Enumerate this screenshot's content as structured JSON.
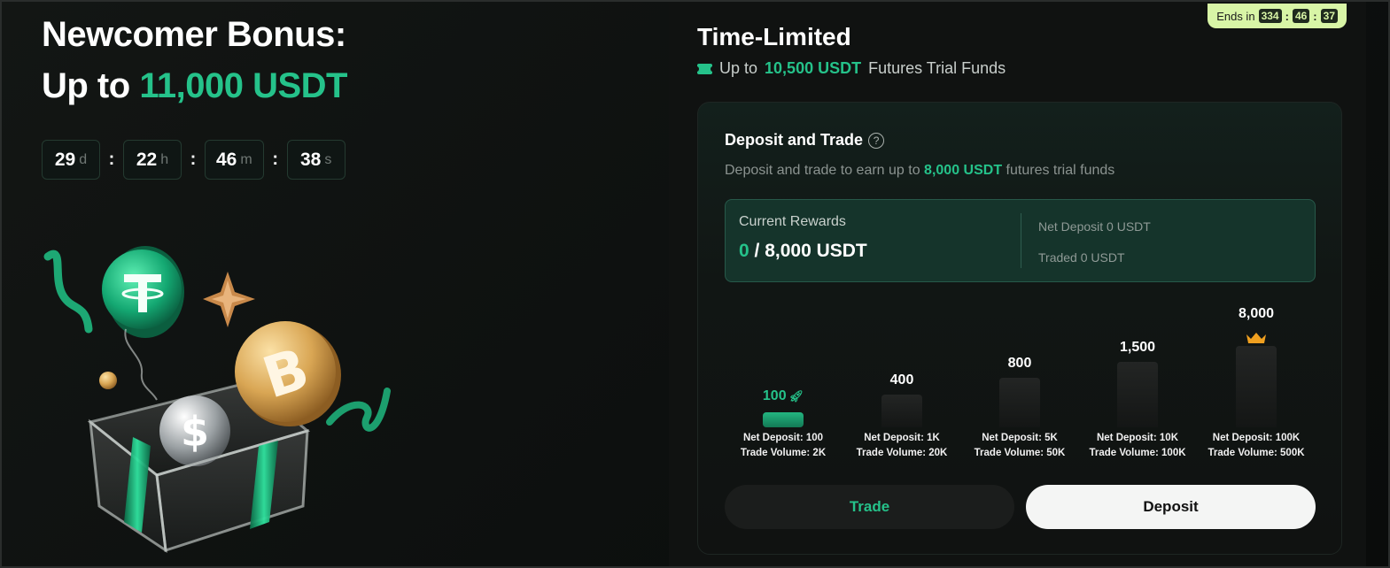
{
  "hero": {
    "title_line1": "Newcomer Bonus:",
    "title_prefix": "Up to",
    "title_amount": "11,000 USDT"
  },
  "countdown": [
    {
      "value": "29",
      "unit": "d"
    },
    {
      "value": "22",
      "unit": "h"
    },
    {
      "value": "46",
      "unit": "m"
    },
    {
      "value": "38",
      "unit": "s"
    }
  ],
  "countdown_separator": ":",
  "badge": {
    "label": "Ends in",
    "h": "334",
    "m": "46",
    "s": "37",
    "sep": ":"
  },
  "panel": {
    "title": "Time-Limited",
    "sub_prefix": "Up to",
    "sub_amount": "10,500 USDT",
    "sub_suffix": "Futures Trial Funds"
  },
  "card": {
    "title": "Deposit and Trade",
    "help_icon": "?",
    "desc_prefix": "Deposit and trade to earn up to",
    "desc_amount": "8,000 USDT",
    "desc_suffix": "futures trial funds",
    "rewards_label": "Current Rewards",
    "rewards_current": "0",
    "rewards_total": "/ 8,000 USDT",
    "net_deposit": "Net Deposit 0 USDT",
    "traded": "Traded 0 USDT"
  },
  "tiers": [
    {
      "amount": "100",
      "level": 1,
      "deposit": "Net Deposit: 100",
      "volume": "Trade Volume: 2K",
      "active": true,
      "icon": "rocket-icon"
    },
    {
      "amount": "400",
      "level": 2,
      "deposit": "Net Deposit: 1K",
      "volume": "Trade Volume: 20K",
      "active": false
    },
    {
      "amount": "800",
      "level": 3,
      "deposit": "Net Deposit: 5K",
      "volume": "Trade Volume: 50K",
      "active": false
    },
    {
      "amount": "1,500",
      "level": 4,
      "deposit": "Net Deposit: 10K",
      "volume": "Trade Volume: 100K",
      "active": false
    },
    {
      "amount": "8,000",
      "level": 5,
      "deposit": "Net Deposit: 100K",
      "volume": "Trade Volume: 500K",
      "active": false,
      "icon": "crown-icon"
    }
  ],
  "buttons": {
    "trade": "Trade",
    "deposit": "Deposit"
  },
  "colors": {
    "accent": "#25c28a",
    "badge": "#d8f5a6",
    "crown": "#f0a020"
  }
}
